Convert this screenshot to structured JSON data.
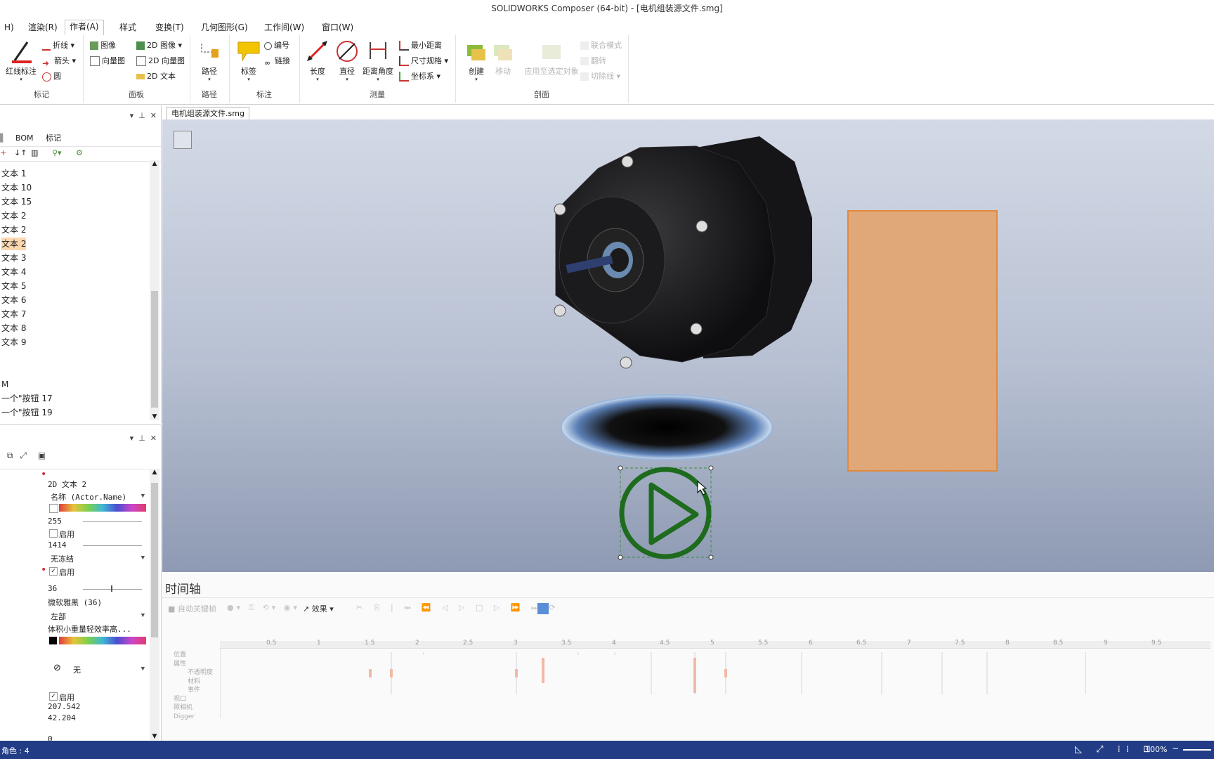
{
  "window": {
    "title": "SOLIDWORKS Composer (64-bit) - [电机组装源文件.smg]"
  },
  "menu": [
    {
      "label": "H)"
    },
    {
      "label": "渲染(R)"
    },
    {
      "label": "作者(A)"
    },
    {
      "label": "样式"
    },
    {
      "label": "变换(T)"
    },
    {
      "label": "几何图形(G)"
    },
    {
      "label": "工作间(W)"
    },
    {
      "label": "窗口(W)"
    }
  ],
  "ribbon": {
    "groups": {
      "mark": "标记",
      "panel": "面板",
      "path": "路径",
      "annot": "标注",
      "measure": "测量",
      "section": "剖面"
    },
    "mark": {
      "redline": "红线标注",
      "polyline": "折线",
      "arrow": "箭头",
      "circle": "圆"
    },
    "panel": {
      "image": "图像",
      "vector": "向量图",
      "img2d": "2D 图像",
      "vec2d": "2D 向量图",
      "text2d": "2D 文本"
    },
    "path": {
      "path": "路径"
    },
    "annot": {
      "label": "标签",
      "number": "编号",
      "link": "链接"
    },
    "measure": {
      "length": "长度",
      "diameter": "直径",
      "dist_angle": "距离角度",
      "min_dist": "最小距离",
      "dim": "尺寸规格",
      "coord": "坐标系"
    },
    "section": {
      "create": "创建",
      "move": "移动",
      "apply": "应用至选定对象",
      "joint": "联合模式",
      "flip": "翻转",
      "cutline": "切除线"
    }
  },
  "left_panel": {
    "tabs": [
      "BOM",
      "标记"
    ],
    "tree_items": [
      "文本 1",
      "文本 10",
      "文本 15",
      "文本 2",
      "文本 2",
      "文本 2",
      "文本 3",
      "文本 4",
      "文本 5",
      "文本 6",
      "文本 7",
      "文本 8",
      "文本 9"
    ],
    "selected_index": 5,
    "section_label": "M",
    "button_items": [
      "一个\"按钮 17",
      "一个\"按钮 19"
    ]
  },
  "properties": {
    "object_name": "2D 文本 2",
    "name_dropdown": "名称 (Actor.Name)",
    "value_255": "255",
    "enable_1": "启用",
    "value_1414": "1414",
    "freeze_dropdown": "无冻结",
    "enable_2": "启用",
    "font_size": "36",
    "font_name": "微软雅黑 (36)",
    "align": "左部",
    "text_value": "体积小重量轻效率高...",
    "none_label": "无",
    "enable_3": "启用",
    "coord_x": "207.542",
    "coord_y": "42.204",
    "coord_z": "0"
  },
  "document_tab": "电机组装源文件.smg",
  "timeline": {
    "title": "时间轴",
    "auto_key": "自动关键帧",
    "effects": "效果",
    "ticks": [
      "0.5",
      "1",
      "1.5",
      "2",
      "2.5",
      "3",
      "3.5",
      "4",
      "4.5",
      "5",
      "5.5",
      "6",
      "6.5",
      "7",
      "7.5",
      "8",
      "8.5",
      "9",
      "9.5"
    ],
    "tracks": [
      "位置",
      "属性",
      "不透明度",
      "材料",
      "事件",
      "视口",
      "照相机",
      "Digger"
    ]
  },
  "status": {
    "left": "角色 : 4",
    "zoom": "100%"
  },
  "colors": {
    "accent": "#223d86",
    "selection": "#fcd7b0",
    "play_green": "#1e6b1e",
    "orange_rect": "#e0a878"
  }
}
